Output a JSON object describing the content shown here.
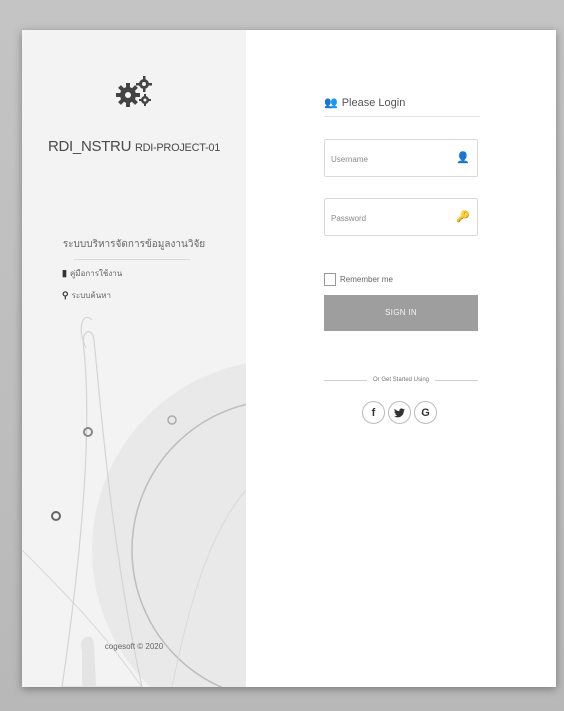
{
  "brand": {
    "title_main": "RDI_NSTRU",
    "title_sub": "RDI-PROJECT-01",
    "subtitle_thai": "ระบบบริหารจัดการข้อมูลงานวิจัย",
    "copyright": "cogesoft © 2020"
  },
  "left_links": [
    {
      "icon": "book-icon",
      "label": "คู่มือการใช้งาน"
    },
    {
      "icon": "search-icon",
      "label": "ระบบค้นหา"
    }
  ],
  "login": {
    "heading": "Please Login",
    "username_placeholder": "Username",
    "password_placeholder": "Password",
    "remember_label": "Remember me",
    "signin_label": "SIGN IN",
    "or_text": "Or Get Started Using",
    "social": [
      {
        "icon": "facebook-icon",
        "glyph": "f"
      },
      {
        "icon": "twitter-icon",
        "glyph": "🐦"
      },
      {
        "icon": "google-icon",
        "glyph": "G"
      }
    ]
  },
  "colors": {
    "background": "#bdbdbd",
    "panel_left": "#f3f3f3",
    "signin_button": "#9e9e9e"
  }
}
